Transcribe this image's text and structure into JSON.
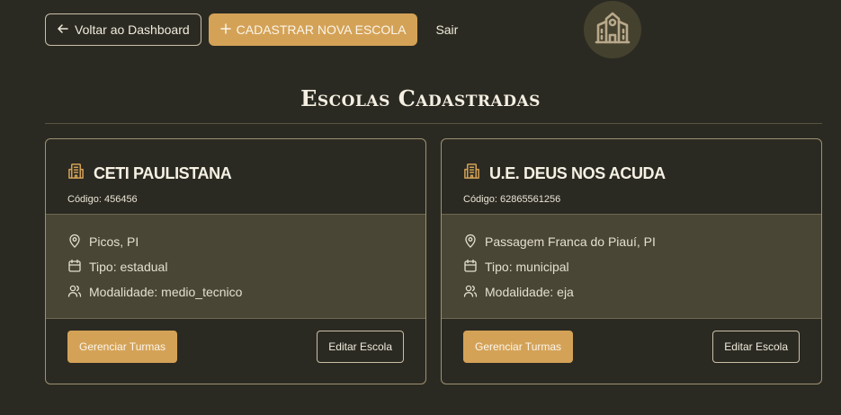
{
  "header": {
    "back_label": "Voltar ao Dashboard",
    "new_school_label": "CADASTRAR NOVA ESCOLA",
    "logout_label": "Sair"
  },
  "page": {
    "title": "Escolas Cadastradas"
  },
  "icons": {
    "back": "arrow-left-icon",
    "plus": "plus-icon",
    "logo": "school-icon",
    "school": "building-icon",
    "location": "map-pin-icon",
    "type": "calendar-icon",
    "modality": "users-icon"
  },
  "colors": {
    "background": "#2b2a22",
    "accent": "#d4a257",
    "card_body": "#4a4635"
  },
  "schools": [
    {
      "name": "CETI PAULISTANA",
      "code": "Código: 456456",
      "location": "Picos, PI",
      "type": "Tipo: estadual",
      "modality": "Modalidade: medio_tecnico",
      "manage_label": "Gerenciar Turmas",
      "edit_label": "Editar Escola"
    },
    {
      "name": "U.E. DEUS NOS ACUDA",
      "code": "Código: 62865561256",
      "location": "Passagem Franca do Piauí, PI",
      "type": "Tipo: municipal",
      "modality": "Modalidade: eja",
      "manage_label": "Gerenciar Turmas",
      "edit_label": "Editar Escola"
    }
  ]
}
